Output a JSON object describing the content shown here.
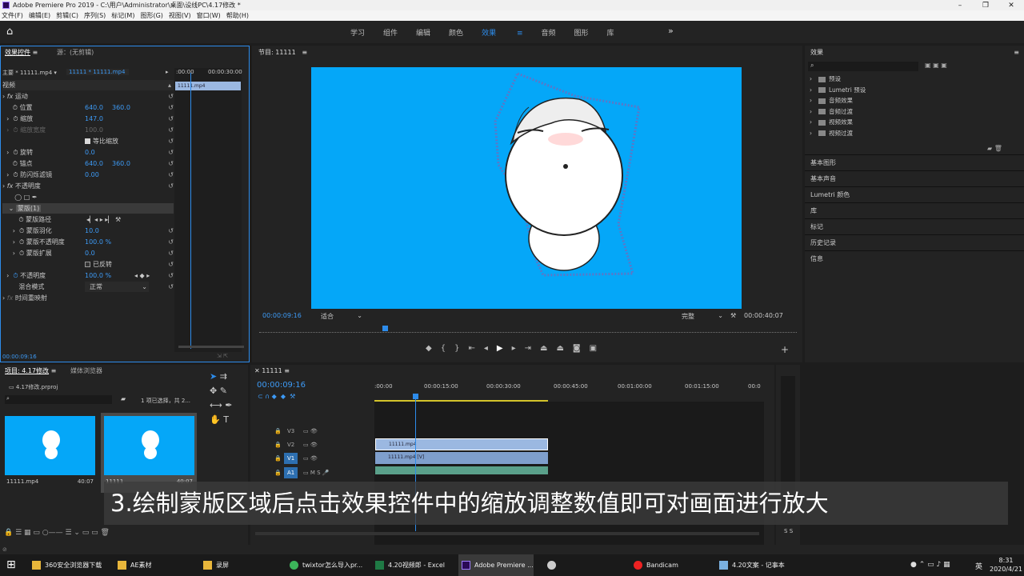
{
  "window": {
    "title": "Adobe Premiere Pro 2019 - C:\\用户\\Administrator\\桌面\\设线PC\\4.17修改 *",
    "min": "–",
    "max": "❐",
    "close": "✕"
  },
  "menu": [
    "文件(F)",
    "编辑(E)",
    "剪辑(C)",
    "序列(S)",
    "标记(M)",
    "图形(G)",
    "视图(V)",
    "窗口(W)",
    "帮助(H)"
  ],
  "workspaces": {
    "tabs": [
      "学习",
      "组件",
      "编辑",
      "颜色",
      "效果",
      "音频",
      "图形",
      "库"
    ],
    "active": "效果",
    "more": "»",
    "home_icon": "home-icon"
  },
  "effect_controls": {
    "tab": "效果控件",
    "tab_menu": "≡",
    "source_tab": "源：(无剪辑)",
    "master": "主要 * 11111.mp4",
    "sequence_clip": "11111 * 11111.mp4",
    "time_start": ":00:00",
    "time_end": "00:00:30:00",
    "clip_label": "11111.mp4",
    "video": "视频",
    "motion": "运动",
    "position": "位置",
    "pos_x": "640.0",
    "pos_y": "360.0",
    "scale": "缩放",
    "scale_v": "147.0",
    "scale_w": "缩放宽度",
    "scale_w_v": "100.0",
    "uniform": "等比缩放",
    "rotation": "旋转",
    "rotation_v": "0.0",
    "anchor": "锚点",
    "anchor_x": "640.0",
    "anchor_y": "360.0",
    "flicker": "防闪烁滤镜",
    "flicker_v": "0.00",
    "opacity": "不透明度",
    "mask": "蒙版(1)",
    "mask_path": "蒙版路径",
    "mask_feather": "蒙版羽化",
    "mask_feather_v": "10.0",
    "mask_opacity": "蒙版不透明度",
    "mask_opacity_v": "100.0 %",
    "mask_expand": "蒙版扩展",
    "mask_expand_v": "0.0",
    "inverted": "已反转",
    "opacity_label": "不透明度",
    "opacity_v": "100.0 %",
    "blend": "混合模式",
    "blend_v": "正常",
    "time_remap": "时间重映射",
    "timecode": "00:00:09:16"
  },
  "program": {
    "title": "节目: 11111",
    "menu": "≡",
    "timecode": "00:00:09:16",
    "fit": "适合",
    "quality": "完整",
    "duration": "00:00:40:07",
    "controls": [
      "marker-icon",
      "in-icon",
      "out-icon",
      "go-in-icon",
      "step-back-icon",
      "play-icon",
      "step-forward-icon",
      "go-out-icon",
      "lift-icon",
      "extract-icon",
      "export-frame-icon",
      "compare-icon"
    ],
    "add": "+"
  },
  "effects": {
    "title": "效果",
    "menu": "≡",
    "search_placeholder": "",
    "folders": [
      "预设",
      "Lumetri 预设",
      "音频效果",
      "音频过渡",
      "视频效果",
      "视频过渡"
    ],
    "sections": [
      "基本图形",
      "基本声音",
      "Lumetri 颜色",
      "库",
      "标记",
      "历史记录",
      "信息"
    ]
  },
  "project": {
    "tab": "项目: 4.17修改",
    "menu": "≡",
    "tab2": "媒体浏览器",
    "file": "4.17修改.prproj",
    "selection": "1 项已选择，共 2...",
    "items": [
      {
        "name": "11111.mp4",
        "dur": "40:07"
      },
      {
        "name": "11111",
        "dur": "40:07"
      }
    ]
  },
  "sequence": {
    "tab": "11111",
    "menu": "≡",
    "timecode": "00:00:09:16",
    "ruler": [
      ":00:00",
      "00:00:15:00",
      "00:00:30:00",
      "00:00:45:00",
      "00:01:00:00",
      "00:01:15:00",
      "00:0"
    ],
    "tracks": [
      "V3",
      "V2",
      "V1",
      "A1"
    ],
    "clip_v2": "11111.mp4",
    "clip_v1": "11111.mp4 [V]"
  },
  "audio_meter": {
    "labels": [
      "S",
      "S"
    ]
  },
  "caption": "3.绘制蒙版区域后点击效果控件中的缩放调整数值即可对画面进行放大",
  "taskbar": {
    "items": [
      "360安全浏览器下载",
      "AE素材",
      "录屏",
      "twixtor怎么导入pr...",
      "4.20视频郎 - Excel",
      "Adobe Premiere ...",
      "",
      "Bandicam",
      "4.20文案 - 记事本"
    ],
    "ime": "英",
    "time": "8:31",
    "date": "2020/4/21"
  },
  "colors": {
    "accent": "#2d8ceb",
    "screen": "#05a7f8",
    "clip": "#9bb8e1"
  }
}
